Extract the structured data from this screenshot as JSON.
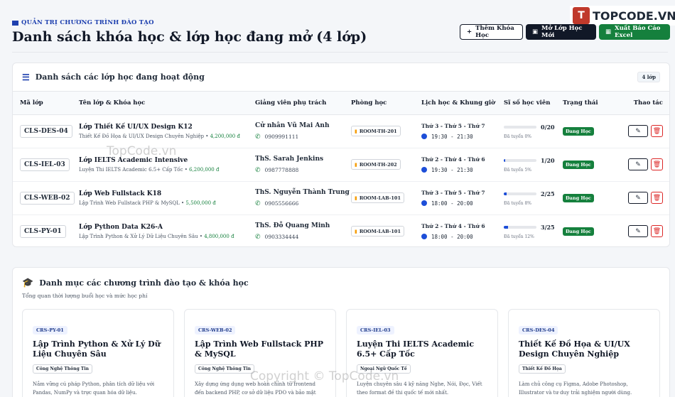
{
  "header": {
    "eyebrow": "QUẢN TRỊ CHƯƠNG TRÌNH ĐÀO TẠO",
    "title": "Danh sách khóa học & lớp học đang mở (4 lớp)",
    "add_label": "Thêm Khóa Học",
    "open_label": "Mở Lớp Học Mới",
    "export_label": "Xuất Báo Cáo Excel"
  },
  "logo": {
    "mark": "T",
    "text": "TOPCODE.VN"
  },
  "classes_card": {
    "title": "Danh sách các lớp học đang hoạt động",
    "count": "4 lớp",
    "columns": [
      "Mã lớp",
      "Tên lớp & Khóa học",
      "Giảng viên phụ trách",
      "Phòng học",
      "Lịch học & Khung giờ",
      "Sĩ số học viên",
      "Trạng thái",
      "Thao tác"
    ],
    "rows": [
      {
        "code": "CLS-DES-04",
        "name": "Lớp Thiết Kế UI/UX Design K12",
        "course": "Thiết Kế Đồ Họa & UI/UX Design Chuyên Nghiệp",
        "price": "4,200,000 đ",
        "teacher": "Cử nhân Vũ Mai Anh",
        "phone": "0909991111",
        "room": "ROOM-TH-201",
        "days": "Thứ 3 - Thứ 5 - Thứ 7",
        "time": "19:30 - 21:30",
        "enrolled": "0/20",
        "percent": 0,
        "fill_label": "Đã tuyển 0%",
        "status": "Đang Học"
      },
      {
        "code": "CLS-IEL-03",
        "name": "Lớp IELTS Academic Intensive",
        "course": "Luyện Thi IELTS Academic 6.5+ Cấp Tốc",
        "price": "6,200,000 đ",
        "teacher": "ThS. Sarah Jenkins",
        "phone": "0987778888",
        "room": "ROOM-TH-202",
        "days": "Thứ 2 - Thứ 4 - Thứ 6",
        "time": "19:30 - 21:30",
        "enrolled": "1/20",
        "percent": 5,
        "fill_label": "Đã tuyển 5%",
        "status": "Đang Học"
      },
      {
        "code": "CLS-WEB-02",
        "name": "Lớp Web Fullstack K18",
        "course": "Lập Trình Web Fullstack PHP & MySQL",
        "price": "5,500,000 đ",
        "teacher": "ThS. Nguyễn Thành Trung",
        "phone": "0905556666",
        "room": "ROOM-LAB-101",
        "days": "Thứ 3 - Thứ 5 - Thứ 7",
        "time": "18:00 - 20:00",
        "enrolled": "2/25",
        "percent": 8,
        "fill_label": "Đã tuyển 8%",
        "status": "Đang Học"
      },
      {
        "code": "CLS-PY-01",
        "name": "Lớp Python Data K26-A",
        "course": "Lập Trình Python & Xử Lý Dữ Liệu Chuyên Sâu",
        "price": "4,800,000 đ",
        "teacher": "ThS. Đỗ Quang Minh",
        "phone": "0903334444",
        "room": "ROOM-LAB-101",
        "days": "Thứ 2 - Thứ 4 - Thứ 6",
        "time": "18:00 - 20:00",
        "enrolled": "3/25",
        "percent": 12,
        "fill_label": "Đã tuyển 12%",
        "status": "Đang Học"
      }
    ]
  },
  "programs": {
    "title": "Danh mục các chương trình đào tạo & khóa học",
    "subtitle": "Tổng quan thời lượng buổi học và mức học phí",
    "items": [
      {
        "code": "CRS-PY-01",
        "title": "Lập Trình Python & Xử Lý Dữ Liệu Chuyên Sâu",
        "category": "Công Nghệ Thông Tin",
        "desc": "Nắm vững cú pháp Python, phân tích dữ liệu với Pandas, NumPy và trực quan hóa dữ liệu."
      },
      {
        "code": "CRS-WEB-02",
        "title": "Lập Trình Web Fullstack PHP & MySQL",
        "category": "Công Nghệ Thông Tin",
        "desc": "Xây dựng ứng dụng web hoàn chỉnh từ frontend đến backend PHP, cơ sở dữ liệu PDO và bảo mật web."
      },
      {
        "code": "CRS-IEL-03",
        "title": "Luyện Thi IELTS Academic 6.5+ Cấp Tốc",
        "category": "Ngoại Ngữ Quốc Tế",
        "desc": "Luyện chuyên sâu 4 kỹ năng Nghe, Nói, Đọc, Viết theo format đề thi quốc tế mới nhất."
      },
      {
        "code": "CRS-DES-04",
        "title": "Thiết Kế Đồ Họa & UI/UX Design Chuyên Nghiệp",
        "category": "Thiết Kế Đồ Họa",
        "desc": "Làm chủ công cụ Figma, Adobe Photoshop, Illustrator và tư duy trải nghiệm người dùng."
      }
    ]
  },
  "watermarks": {
    "mid": "TopCode.vn",
    "bottom": "Copyright © TopCode.vn"
  },
  "colors": {
    "primary": "#111827",
    "accent": "#1e40af",
    "success": "#15803d",
    "danger": "#dc2626"
  }
}
